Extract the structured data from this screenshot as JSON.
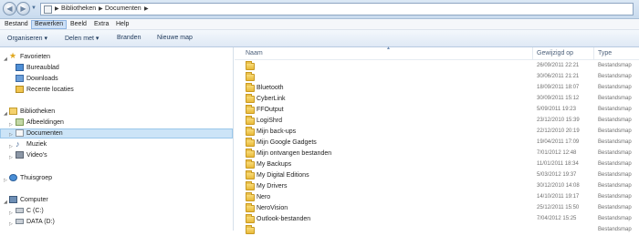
{
  "address": {
    "crumbs": [
      "Bibliotheken",
      "Documenten"
    ],
    "separator": "▶"
  },
  "menu": [
    {
      "label": "Bestand",
      "active": false
    },
    {
      "label": "Bewerken",
      "active": true
    },
    {
      "label": "Beeld",
      "active": false
    },
    {
      "label": "Extra",
      "active": false
    },
    {
      "label": "Help",
      "active": false
    }
  ],
  "toolbar": {
    "organize": "Organiseren ▾",
    "share": "Delen met ▾",
    "burn": "Branden",
    "new_folder": "Nieuwe map"
  },
  "nav": {
    "favorites": "Favorieten",
    "desktop": "Bureaublad",
    "downloads": "Downloads",
    "recent": "Recente locaties",
    "libraries": "Bibliotheken",
    "pictures": "Afbeeldingen",
    "documents": "Documenten",
    "music": "Muziek",
    "videos": "Video's",
    "homegroup": "Thuisgroep",
    "computer": "Computer",
    "drive_c": "C (C:)",
    "drive_d": "DATA (D:)"
  },
  "columns": {
    "name": "Naam",
    "modified": "Gewijzigd op",
    "type": "Type"
  },
  "files": [
    {
      "name": "",
      "modified": "26/09/2011 22:21",
      "type": "Bestandsmap"
    },
    {
      "name": "",
      "modified": "30/06/2011 21:21",
      "type": "Bestandsmap"
    },
    {
      "name": "Bluetooth",
      "modified": "18/09/2011 18:07",
      "type": "Bestandsmap"
    },
    {
      "name": "CyberLink",
      "modified": "30/09/2011 15:12",
      "type": "Bestandsmap"
    },
    {
      "name": "FFOutput",
      "modified": "5/09/2011 19:23",
      "type": "Bestandsmap"
    },
    {
      "name": "LogiShrd",
      "modified": "23/12/2010 15:39",
      "type": "Bestandsmap"
    },
    {
      "name": "Mijn back-ups",
      "modified": "22/12/2010 20:19",
      "type": "Bestandsmap"
    },
    {
      "name": "Mijn Google Gadgets",
      "modified": "19/04/2011 17:09",
      "type": "Bestandsmap"
    },
    {
      "name": "Mijn ontvangen bestanden",
      "modified": "7/01/2012 12:48",
      "type": "Bestandsmap"
    },
    {
      "name": "My Backups",
      "modified": "11/01/2011 18:34",
      "type": "Bestandsmap"
    },
    {
      "name": "My Digital Editions",
      "modified": "5/03/2012 19:37",
      "type": "Bestandsmap"
    },
    {
      "name": "My Drivers",
      "modified": "30/12/2010 14:08",
      "type": "Bestandsmap"
    },
    {
      "name": "Nero",
      "modified": "14/10/2011 19:17",
      "type": "Bestandsmap"
    },
    {
      "name": "NeroVision",
      "modified": "25/12/2011 15:50",
      "type": "Bestandsmap"
    },
    {
      "name": "Outlook-bestanden",
      "modified": "7/04/2012 15:25",
      "type": "Bestandsmap"
    },
    {
      "name": "",
      "modified": "",
      "type": "Bestandsmap"
    }
  ]
}
